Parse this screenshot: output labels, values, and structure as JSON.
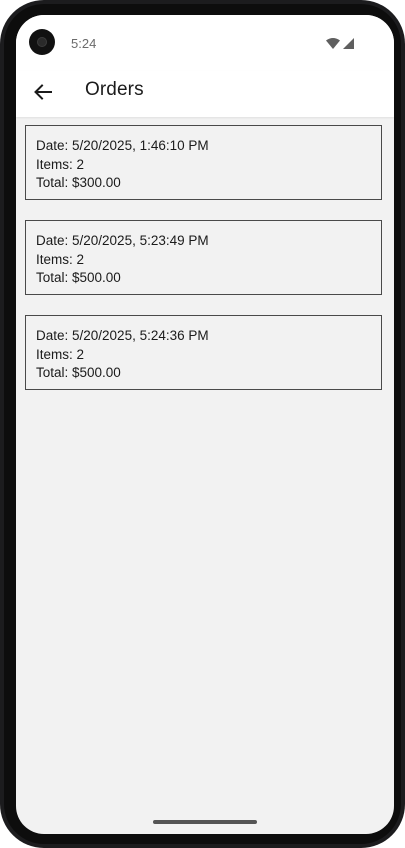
{
  "status_bar": {
    "time": "5:24",
    "icons": [
      "wifi-icon",
      "cell-signal-icon"
    ]
  },
  "app_bar": {
    "title": "Orders",
    "back_icon": "arrow-back-icon"
  },
  "orders": [
    {
      "date": "Date: 5/20/2025, 1:46:10 PM",
      "items": "Items: 2",
      "total": "Total: $300.00"
    },
    {
      "date": "Date: 5/20/2025, 5:23:49 PM",
      "items": "Items: 2",
      "total": "Total: $500.00"
    },
    {
      "date": "Date: 5/20/2025, 5:24:36 PM",
      "items": "Items: 2",
      "total": "Total: $500.00"
    }
  ],
  "colors": {
    "background": "#f2f2f2",
    "app_bar": "#ffffff",
    "card_border": "#4a4a4a",
    "text": "#1b1b1b"
  }
}
